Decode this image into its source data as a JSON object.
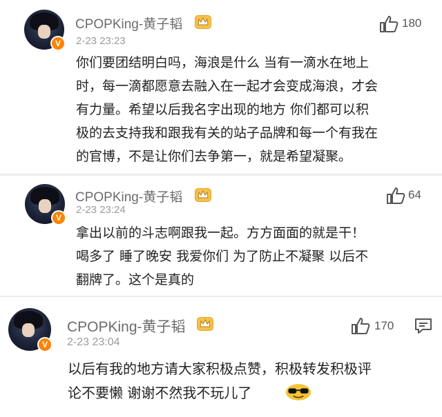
{
  "comments": [
    {
      "author": "CPOPKing-黄子韬",
      "time": "2-23 23:23",
      "likes": "180",
      "lines": [
        "你们要团结明白吗，海浪是什么 当有一滴水在地上",
        "时，每一滴都愿意去融入在一起才会变成海浪，才会",
        "有力量。希望以后我名字出现的地方 你们都可以积",
        "极的去支持我和跟我有关的站子品牌和每一个有我在",
        "的官博，不是让你们去争第一，就是希望凝聚。"
      ]
    },
    {
      "author": "CPOPKing-黄子韬",
      "time": "2-23 23:24",
      "likes": "64",
      "lines": [
        "拿出以前的斗志啊跟我一起。方方面面的就是干！",
        "喝多了 睡了晚安 我爱你们 为了防止不凝聚 以后不",
        "翻牌了。这个是真的"
      ]
    },
    {
      "author": "CPOPKing-黄子韬",
      "time": "2-23 23:04",
      "likes": "170",
      "lines": [
        "以后有我的地方请大家积极点赞，积极转发积极评",
        "论不要懒 谢谢不然我不玩儿了"
      ]
    }
  ],
  "icons": {
    "verified": "V",
    "like": "thumbs-up-icon",
    "comment": "comment-icon",
    "crown": "crown-badge-icon",
    "emoji": "sunglasses-emoji-icon"
  },
  "colors": {
    "verified_badge": "#ff8200",
    "crown_badge": "#f6c14a",
    "text": "#222222",
    "meta": "#9a9a9a"
  }
}
